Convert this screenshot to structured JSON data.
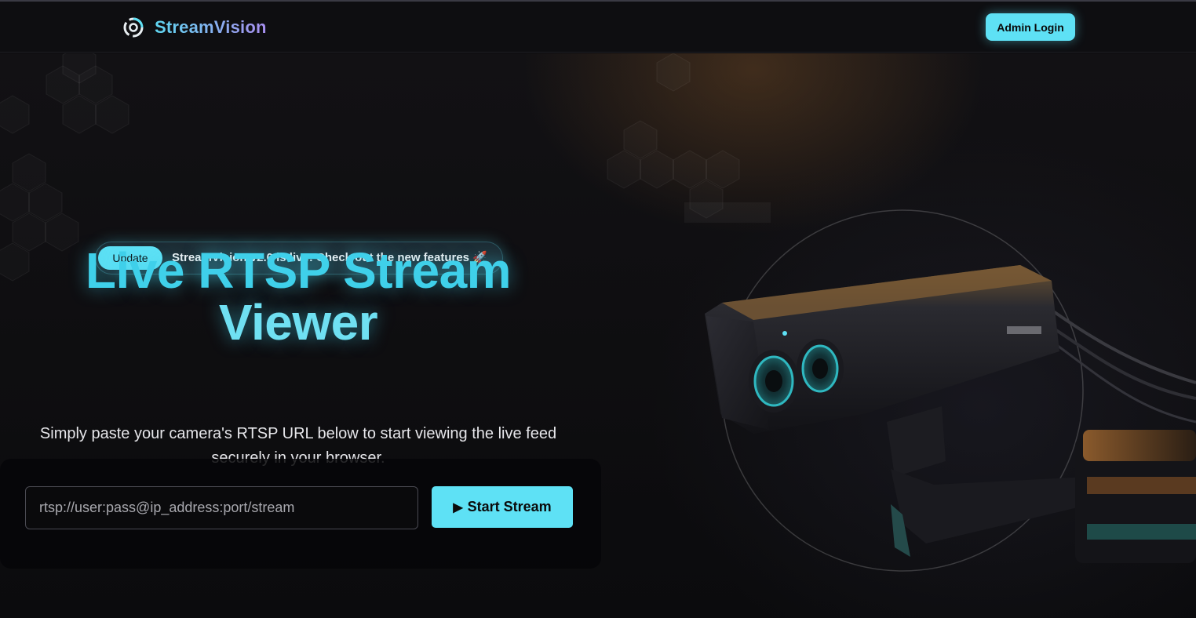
{
  "brand": {
    "name": "StreamVision",
    "logo_icon": "aperture-icon"
  },
  "nav": {
    "admin_login_label": "Admin Login"
  },
  "announcement": {
    "badge": "Update",
    "text": "StreamVision v2.0 is live! Check out the new features 🚀"
  },
  "hero": {
    "title_line1": "Live RTSP Stream",
    "title_line2": "Viewer",
    "subtitle": "Simply paste your camera's RTSP URL below to start viewing the live feed securely in your browser."
  },
  "form": {
    "url_placeholder": "rtsp://user:pass@ip_address:port/stream",
    "url_value": "",
    "start_icon": "play-icon",
    "start_label": "Start Stream"
  },
  "colors": {
    "accent": "#5ee1f5",
    "headline": "#3fd0ea",
    "background": "#0b0b0e"
  }
}
